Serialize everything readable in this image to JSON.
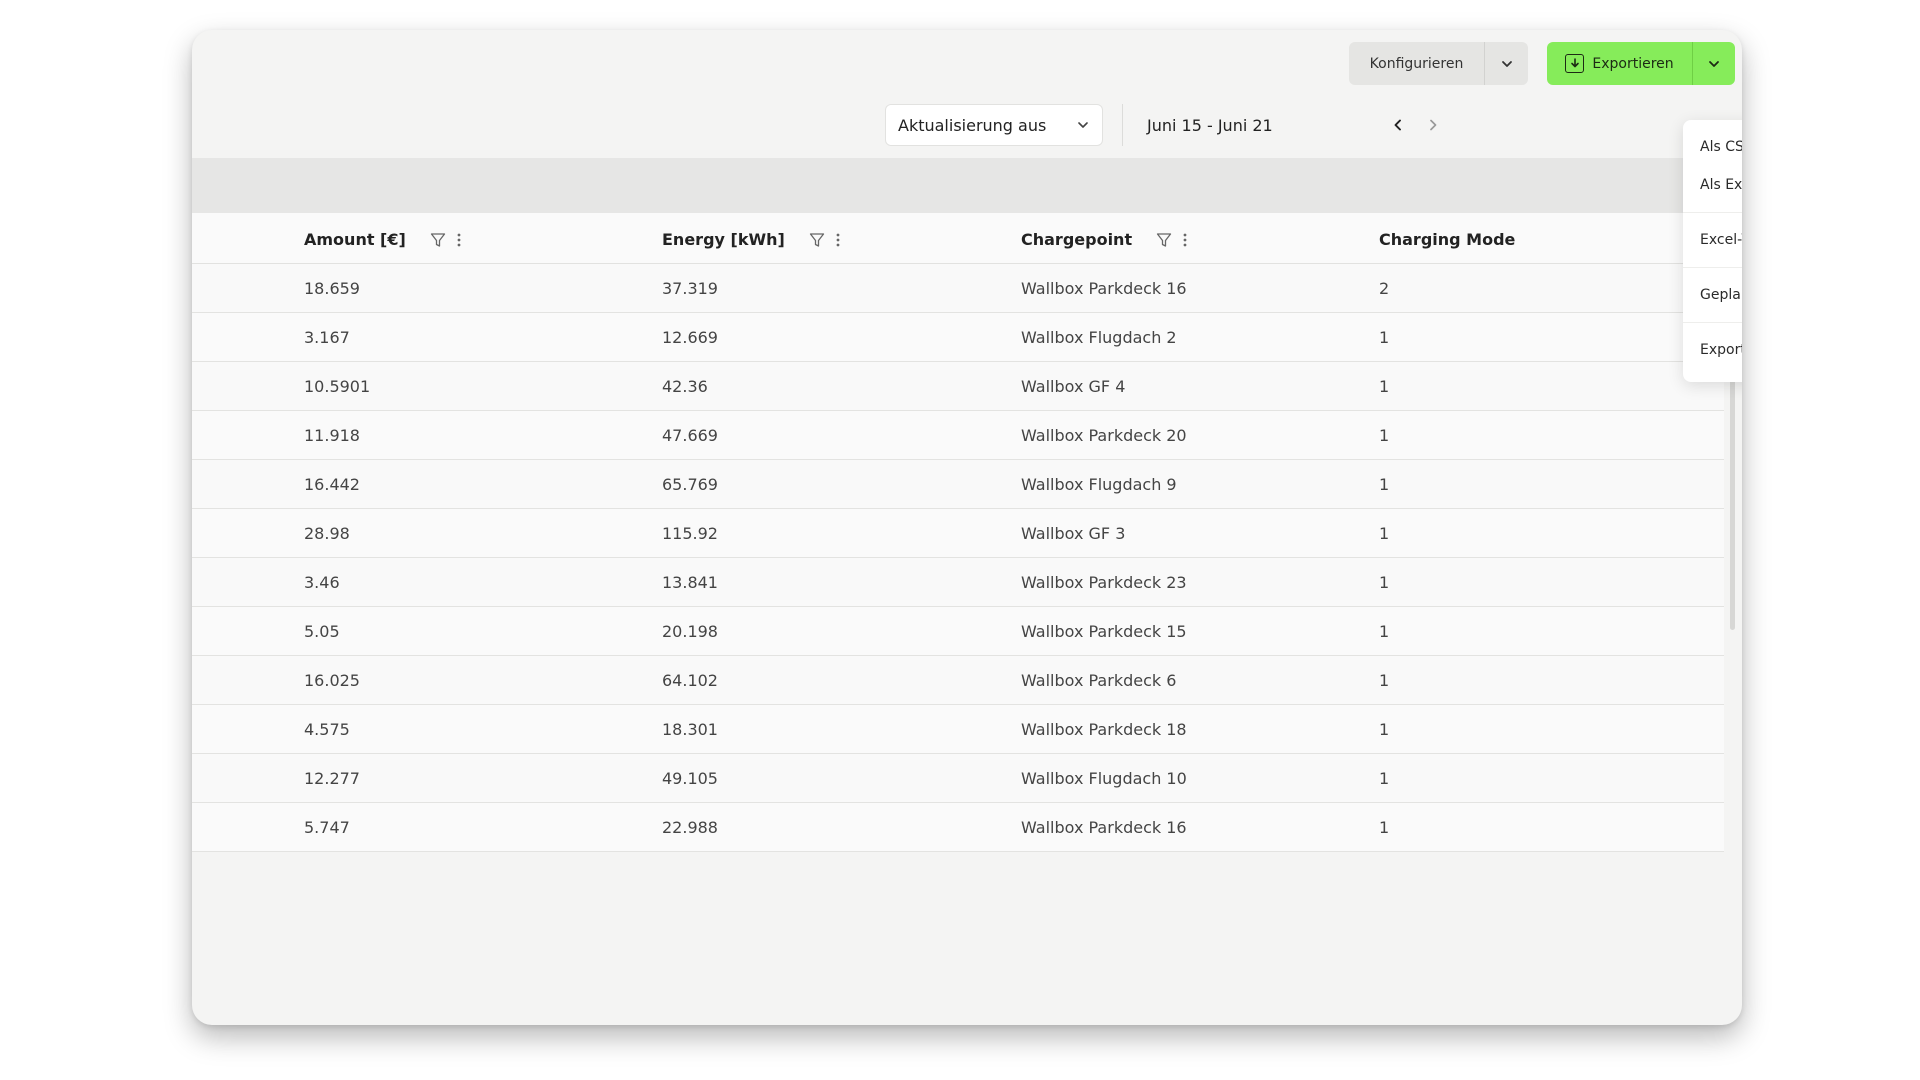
{
  "toolbar": {
    "configure_label": "Konfigurieren",
    "export_label": "Exportieren",
    "export_color": "#86ec5a"
  },
  "filters": {
    "refresh_label": "Aktualisierung aus",
    "date_range": "Juni 15 - Juni 21"
  },
  "export_menu": {
    "items": [
      "Als CSV-Datei exportieren",
      "Als Excel-Tabelle exportieren",
      "Excel-Vorlagen",
      "Geplante Berichte",
      "Exportarchiv"
    ]
  },
  "table": {
    "columns": [
      "Amount [€]",
      "Energy [kWh]",
      "Chargepoint",
      "Charging Mode"
    ],
    "rows": [
      [
        "18.659",
        "37.319",
        "Wallbox Parkdeck 16",
        "2"
      ],
      [
        "3.167",
        "12.669",
        "Wallbox Flugdach 2",
        "1"
      ],
      [
        "10.5901",
        "42.36",
        "Wallbox GF 4",
        "1"
      ],
      [
        "11.918",
        "47.669",
        "Wallbox Parkdeck 20",
        "1"
      ],
      [
        "16.442",
        "65.769",
        "Wallbox Flugdach 9",
        "1"
      ],
      [
        "28.98",
        "115.92",
        "Wallbox GF 3",
        "1"
      ],
      [
        "3.46",
        "13.841",
        "Wallbox Parkdeck 23",
        "1"
      ],
      [
        "5.05",
        "20.198",
        "Wallbox Parkdeck 15",
        "1"
      ],
      [
        "16.025",
        "64.102",
        "Wallbox Parkdeck 6",
        "1"
      ],
      [
        "4.575",
        "18.301",
        "Wallbox Parkdeck 18",
        "1"
      ],
      [
        "12.277",
        "49.105",
        "Wallbox Flugdach 10",
        "1"
      ],
      [
        "5.747",
        "22.988",
        "Wallbox Parkdeck 16",
        "1"
      ]
    ]
  }
}
